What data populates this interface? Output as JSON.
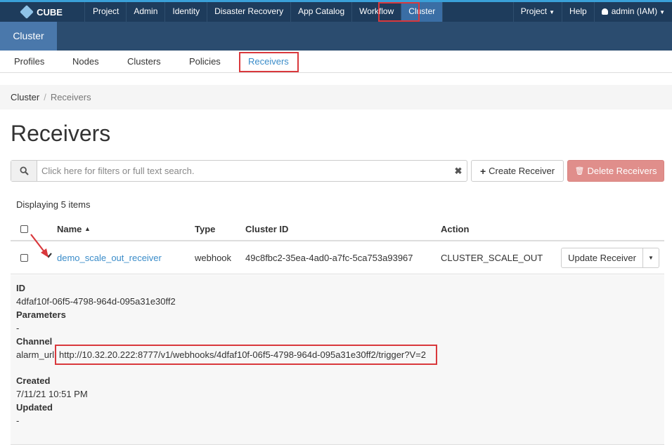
{
  "brand": "CUBE",
  "top_nav": [
    "Project",
    "Admin",
    "Identity",
    "Disaster Recovery",
    "App Catalog",
    "Workflow",
    "Cluster"
  ],
  "top_right": {
    "project": "Project",
    "help": "Help",
    "user": "admin (IAM)"
  },
  "sub_tab": "Cluster",
  "panel_tabs": [
    "Profiles",
    "Nodes",
    "Clusters",
    "Policies",
    "Receivers"
  ],
  "breadcrumb": {
    "root": "Cluster",
    "current": "Receivers"
  },
  "page_title": "Receivers",
  "search": {
    "placeholder": "Click here for filters or full text search."
  },
  "buttons": {
    "create": "Create Receiver",
    "delete": "Delete Receivers"
  },
  "display_count": "Displaying 5 items",
  "table": {
    "headers": {
      "name": "Name",
      "type": "Type",
      "cluster_id": "Cluster ID",
      "action": "Action"
    },
    "row": {
      "name": "demo_scale_out_receiver",
      "type": "webhook",
      "cluster_id": "49c8fbc2-35ea-4ad0-a7fc-5ca753a93967",
      "action": "CLUSTER_SCALE_OUT",
      "update_button": "Update Receiver"
    }
  },
  "detail": {
    "id_label": "ID",
    "id_value": "4dfaf10f-06f5-4798-964d-095a31e30ff2",
    "params_label": "Parameters",
    "params_value": "-",
    "channel_label": "Channel",
    "channel_key": "alarm_url",
    "channel_value": "http://10.32.20.222:8777/v1/webhooks/4dfaf10f-06f5-4798-964d-095a31e30ff2/trigger?V=2",
    "created_label": "Created",
    "created_value": "7/11/21 10:51 PM",
    "updated_label": "Updated",
    "updated_value": "-"
  },
  "colors": {
    "navbar": "#1e3c5c",
    "accent": "#3a8cc9",
    "highlight": "#d9383c",
    "danger": "#e08e8b"
  }
}
